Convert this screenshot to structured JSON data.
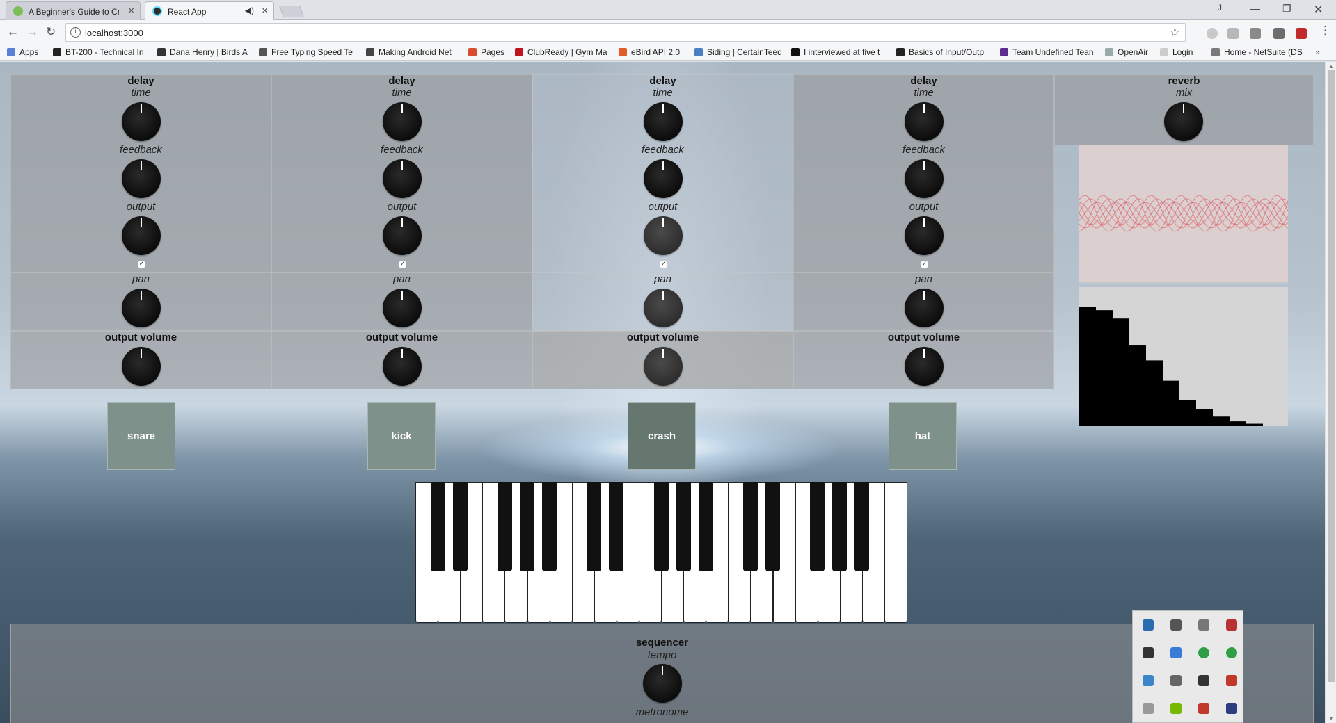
{
  "browser": {
    "tabs": [
      {
        "title": "A Beginner's Guide to Cr",
        "active": false
      },
      {
        "title": "React App",
        "active": true
      }
    ],
    "url": "localhost:3000",
    "bookmarks": [
      "Apps",
      "BT-200 - Technical In",
      "Dana Henry | Birds A",
      "Free Typing Speed Te",
      "Making Android Net",
      "Pages",
      "ClubReady | Gym Ma",
      "eBird API 2.0",
      "Siding | CertainTeed",
      "I interviewed at five t",
      "Basics of Input/Outp",
      "Team Undefined Tean",
      "OpenAir",
      "Login",
      "Home - NetSuite (DS"
    ]
  },
  "effects": [
    {
      "title": "delay",
      "time_label": "time",
      "feedback_label": "feedback",
      "output_label": "output",
      "checked": true,
      "pan_label": "pan",
      "volume_label": "output volume"
    },
    {
      "title": "delay",
      "time_label": "time",
      "feedback_label": "feedback",
      "output_label": "output",
      "checked": true,
      "pan_label": "pan",
      "volume_label": "output volume"
    },
    {
      "title": "delay",
      "time_label": "time",
      "feedback_label": "feedback",
      "output_label": "output",
      "checked": true,
      "pan_label": "pan",
      "volume_label": "output volume"
    },
    {
      "title": "delay",
      "time_label": "time",
      "feedback_label": "feedback",
      "output_label": "output",
      "checked": true,
      "pan_label": "pan",
      "volume_label": "output volume"
    }
  ],
  "reverb": {
    "title": "reverb",
    "mix_label": "mix"
  },
  "pads": [
    "snare",
    "kick",
    "crash",
    "hat"
  ],
  "sequencer": {
    "title": "sequencer",
    "tempo_label": "tempo",
    "metronome_label": "metronome"
  },
  "spectrum_levels": [
    1.0,
    0.97,
    0.9,
    0.68,
    0.55,
    0.38,
    0.22,
    0.14,
    0.08,
    0.04,
    0.02
  ],
  "colors": {
    "pad": "#7f918b",
    "knob": "#111111",
    "waveform": "#e0474c",
    "analyser_bg": "#dbcfd0",
    "spectrum_bar": "#000000"
  },
  "icons": {
    "back": "back-arrow-icon",
    "forward": "forward-arrow-icon",
    "reload": "reload-icon",
    "star": "bookmark-star-icon"
  },
  "tray_icons": [
    "steam-icon",
    "window-icon",
    "headset-icon",
    "app-icon",
    "cloud-icon",
    "drive-icon",
    "check-icon",
    "check-icon",
    "network-icon",
    "usb-icon",
    "shield-icon",
    "gauge-icon",
    "speaker-icon",
    "nvidia-icon",
    "bug-icon",
    "display-icon"
  ]
}
